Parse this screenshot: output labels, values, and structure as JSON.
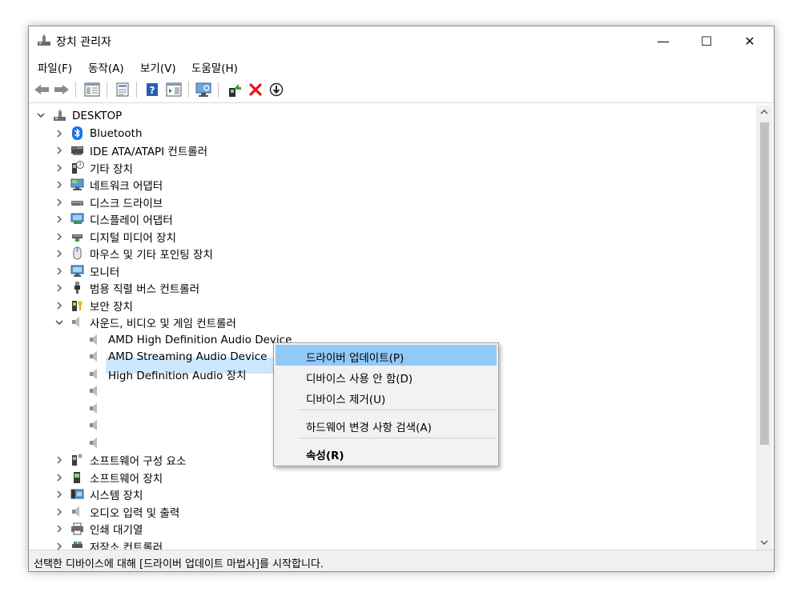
{
  "window": {
    "title": "장치 관리자",
    "minimize_glyph": "—",
    "maximize_glyph": "☐",
    "close_glyph": "✕"
  },
  "menu": [
    "파일(F)",
    "동작(A)",
    "보기(V)",
    "도움말(H)"
  ],
  "toolbar": [
    "back-icon",
    "forward-icon",
    "show-hide-tree-icon",
    "properties-icon",
    "help-icon",
    "action-pane-icon",
    "scan-hardware-icon",
    "update-driver-icon",
    "uninstall-icon",
    "download-icon"
  ],
  "tree": {
    "root": "DESKTOP",
    "categories": [
      {
        "label": "Bluetooth",
        "icon": "bluetooth-icon"
      },
      {
        "label": "IDE ATA/ATAPI 컨트롤러",
        "icon": "ide-controller-icon"
      },
      {
        "label": "기타 장치",
        "icon": "other-devices-icon"
      },
      {
        "label": "네트워크 어댑터",
        "icon": "network-adapter-icon"
      },
      {
        "label": "디스크 드라이브",
        "icon": "disk-drive-icon"
      },
      {
        "label": "디스플레이 어댑터",
        "icon": "display-adapter-icon"
      },
      {
        "label": "디지털 미디어 장치",
        "icon": "digital-media-icon"
      },
      {
        "label": "마우스 및 기타 포인팅 장치",
        "icon": "mouse-icon"
      },
      {
        "label": "모니터",
        "icon": "monitor-icon"
      },
      {
        "label": "범용 직렬 버스 컨트롤러",
        "icon": "usb-icon"
      },
      {
        "label": "보안 장치",
        "icon": "security-device-icon"
      },
      {
        "label": "사운드, 비디오 및 게임 컨트롤러",
        "icon": "speaker-icon",
        "expanded": true
      }
    ],
    "sound_children": [
      "AMD High Definition Audio Device",
      "AMD Streaming Audio Device",
      "High Definition Audio 장치",
      "",
      "",
      "",
      ""
    ],
    "categories_after": [
      {
        "label": "소프트웨어 구성 요소",
        "icon": "software-component-icon"
      },
      {
        "label": "소프트웨어 장치",
        "icon": "software-device-icon"
      },
      {
        "label": "시스템 장치",
        "icon": "system-device-icon"
      },
      {
        "label": "오디오 입력 및 출력",
        "icon": "audio-io-icon"
      },
      {
        "label": "인쇄 대기열",
        "icon": "print-queue-icon"
      },
      {
        "label": "저장소 컨트롤러",
        "icon": "storage-controller-icon"
      }
    ]
  },
  "context_menu": {
    "items": [
      {
        "label": "드라이버 업데이트(P)",
        "highlighted": true
      },
      {
        "label": "디바이스 사용 안 함(D)"
      },
      {
        "label": "디바이스 제거(U)"
      },
      {
        "label": "하드웨어 변경 사항 검색(A)"
      },
      {
        "label": "속성(R)",
        "bold": true
      }
    ]
  },
  "status": "선택한 디바이스에 대해 [드라이버 업데이트 마법사]를 시작합니다.",
  "colors": {
    "selection": "#cce8ff",
    "menu_highlight": "#91c9f7",
    "uninstall_red": "#e81123"
  }
}
